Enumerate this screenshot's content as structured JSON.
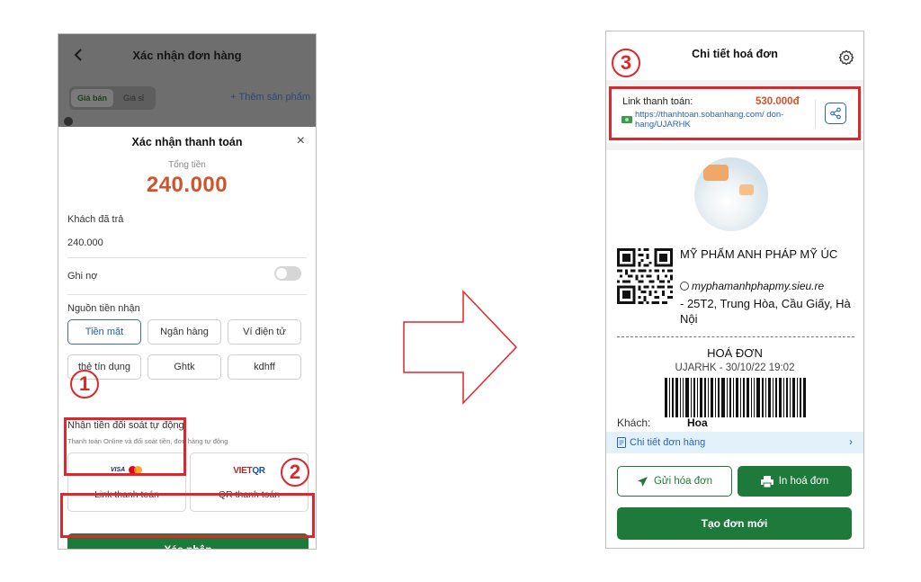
{
  "left_screen": {
    "header_title": "Xác nhận đơn hàng",
    "price_tabs": [
      "Giá bán",
      "Giá sỉ"
    ],
    "add_product": "+ Thêm sản phẩm",
    "sheet": {
      "title": "Xác nhận thanh toán",
      "close": "×",
      "total_label": "Tổng tiền",
      "total_value": "240.000",
      "paid_label": "Khách đã trả",
      "paid_value": "240.000",
      "debt_label": "Ghi nợ",
      "source_label": "Nguồn tiền nhận",
      "sources": [
        "Tiền mặt",
        "Ngân hàng",
        "Ví điện tử",
        "thẻ tín dụng",
        "Ghtk",
        "kdhff"
      ],
      "selected_source": "Tiền mặt",
      "auto_label": "Nhận tiền đối soát tự động",
      "auto_sub": "Thanh toán Online và đối soát tiền, đơn hàng tự động",
      "pay_link": {
        "logo_visa": "VISA",
        "label": "Link thanh toán"
      },
      "pay_qr": {
        "logo_viet": "VIET",
        "logo_qr": "QR",
        "label": "QR thanh toán"
      },
      "confirm": "Xác nhận"
    }
  },
  "annotations": [
    "1",
    "2",
    "3"
  ],
  "right_screen": {
    "header_title": "Chi tiết hoá đơn",
    "link_label": "Link thanh toán:",
    "link_amount": "530.000đ",
    "link_url": "https://thanhtoan.sobanhang.com/ don-hang/UJARHK",
    "shop_name": "MỸ PHẨM ANH PHÁP MỸ ÚC",
    "shop_web": "myphamanhphapmy.sieu.re",
    "shop_address": "- 25T2, Trung Hòa, Cầu Giấy, Hà Nội",
    "invoice_title": "HOÁ ĐƠN",
    "invoice_code": "UJARHK - 30/10/22 19:02",
    "customer_label": "Khách:",
    "customer_value": "Hoa",
    "order_detail": "Chi tiết đơn hàng",
    "send_invoice": "Gửi hóa đơn",
    "print_invoice": "In hoá đơn",
    "new_order": "Tạo đơn mới"
  },
  "colors": {
    "primary_green": "#1d7a3a",
    "accent_orange": "#d0532b",
    "link_blue": "#2a63b8",
    "annotation_red": "#e0262a"
  }
}
